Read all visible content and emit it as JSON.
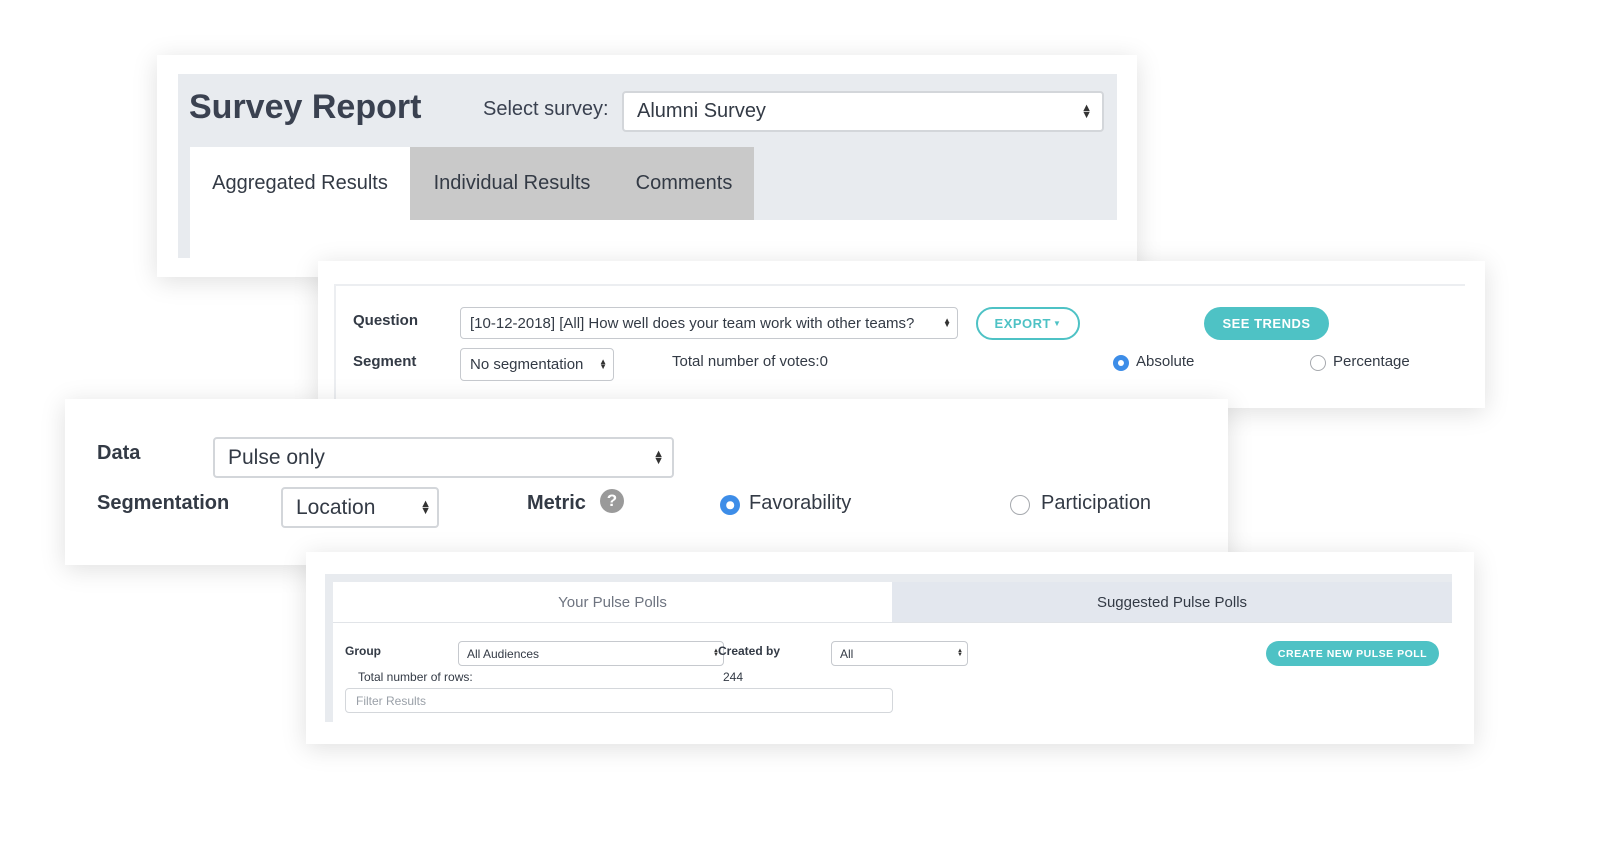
{
  "survey_report": {
    "title": "Survey Report",
    "select_survey_label": "Select survey:",
    "survey_select_value": "Alumni Survey",
    "tabs": [
      {
        "label": "Aggregated Results"
      },
      {
        "label": "Individual Results"
      },
      {
        "label": "Comments"
      }
    ]
  },
  "question_panel": {
    "question_label": "Question",
    "question_value": "[10-12-2018] [All] How well does your team work with other teams?",
    "export_label": "EXPORT",
    "see_trends_label": "SEE TRENDS",
    "segment_label": "Segment",
    "segment_value": "No segmentation",
    "total_votes": "Total number of votes:0",
    "radio_absolute": "Absolute",
    "radio_percentage": "Percentage"
  },
  "data_panel": {
    "data_label": "Data",
    "data_value": "Pulse only",
    "segmentation_label": "Segmentation",
    "segmentation_value": "Location",
    "metric_label": "Metric",
    "radio_favorability": "Favorability",
    "radio_participation": "Participation"
  },
  "pulse_panel": {
    "tab_your": "Your Pulse Polls",
    "tab_suggested": "Suggested Pulse Polls",
    "group_label": "Group",
    "group_value": "All Audiences",
    "created_by_label": "Created by",
    "created_by_value": "All",
    "create_button": "CREATE NEW PULSE POLL",
    "total_rows_label": "Total number of rows:",
    "total_rows_value": "244",
    "filter_placeholder": "Filter Results"
  },
  "colors": {
    "accent_teal": "#4ec2c5",
    "radio_blue": "#3d8de8",
    "tab_inactive_gray": "#c9c9c9",
    "header_bg": "#e8ebef"
  }
}
